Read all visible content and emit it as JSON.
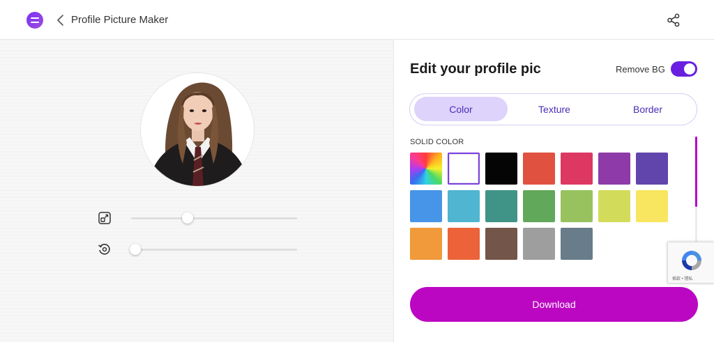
{
  "header": {
    "title": "Profile Picture Maker",
    "logo_icon": "logo-icon",
    "back_icon": "chevron-left-icon",
    "share_icon": "share-icon"
  },
  "editor": {
    "zoom_icon": "zoom-icon",
    "rotate_icon": "rotate-icon",
    "zoom_level": 0.34,
    "rotate_level": 0.0
  },
  "panel": {
    "title": "Edit your profile pic",
    "remove_bg_label": "Remove BG",
    "remove_bg_on": true,
    "tabs": [
      {
        "label": "Color",
        "active": true
      },
      {
        "label": "Texture",
        "active": false
      },
      {
        "label": "Border",
        "active": false
      }
    ],
    "section_label": "SOLID COLOR",
    "colors": [
      {
        "name": "rainbow",
        "value": "conic"
      },
      {
        "name": "white",
        "value": "#ffffff",
        "selected": true
      },
      {
        "name": "black",
        "value": "#050505"
      },
      {
        "name": "red",
        "value": "#e0513f"
      },
      {
        "name": "pink",
        "value": "#dd3862"
      },
      {
        "name": "purple",
        "value": "#8e3aa8"
      },
      {
        "name": "deep-purple",
        "value": "#6145ad"
      },
      {
        "name": "blue",
        "value": "#4795e8"
      },
      {
        "name": "cyan",
        "value": "#50b5d0"
      },
      {
        "name": "teal",
        "value": "#409487"
      },
      {
        "name": "green",
        "value": "#62a85a"
      },
      {
        "name": "light-green",
        "value": "#98c25e"
      },
      {
        "name": "lime",
        "value": "#d3dc5a"
      },
      {
        "name": "yellow",
        "value": "#f9e660"
      },
      {
        "name": "orange",
        "value": "#f09a3c"
      },
      {
        "name": "deep-orange",
        "value": "#ec6339"
      },
      {
        "name": "brown",
        "value": "#73554a"
      },
      {
        "name": "grey",
        "value": "#9e9e9e"
      },
      {
        "name": "blue-grey",
        "value": "#687c8a"
      }
    ],
    "download_label": "Download"
  },
  "recaptcha": {
    "links": "條款 • 隱私"
  },
  "colors": {
    "accent": "#bb07c2",
    "toggle": "#6a1fe0",
    "tab_active_bg": "#ddd3fb",
    "tab_text": "#4a2db6"
  }
}
